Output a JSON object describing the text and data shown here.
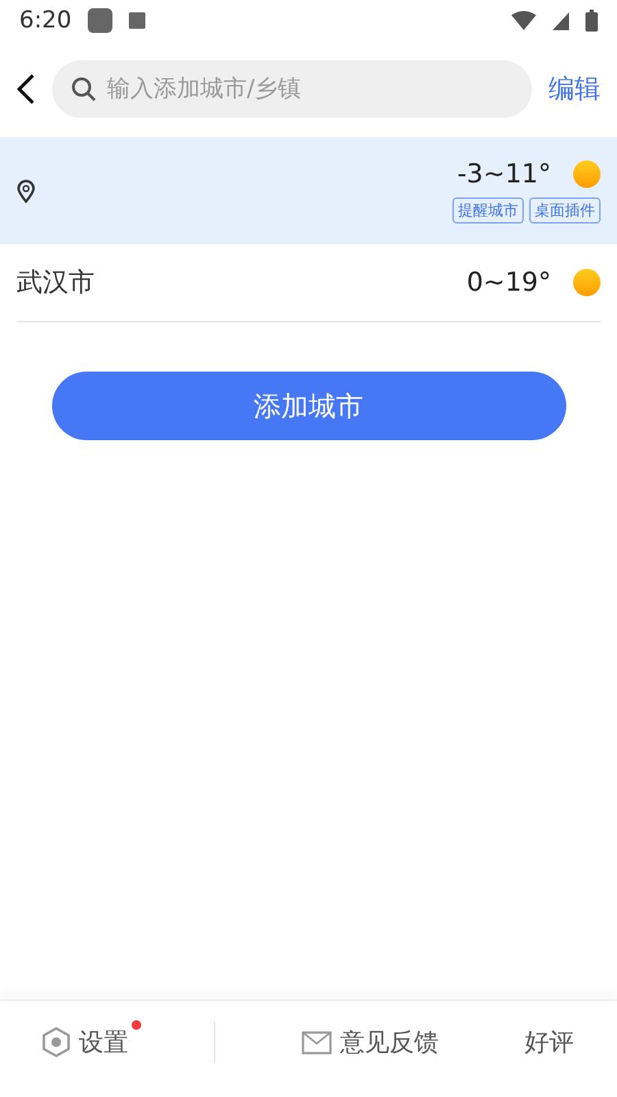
{
  "status_bar": {
    "time": "6:20"
  },
  "header": {
    "search": {
      "placeholder": "输入添加城市/乡镇"
    },
    "edit": "编辑"
  },
  "cities": [
    {
      "kind": "location",
      "temp": "-3~11°",
      "selected": true,
      "tags": [
        "提醒城市",
        "桌面插件"
      ]
    },
    {
      "kind": "city",
      "name": "武汉市",
      "temp": "0~19°",
      "selected": false
    }
  ],
  "add_button": "添加城市",
  "bottom_bar": [
    {
      "kind": "settings",
      "label": "设置",
      "badge": true
    },
    {
      "kind": "feedback",
      "label": "意见反馈"
    },
    {
      "kind": "plain",
      "label": "好评"
    }
  ]
}
